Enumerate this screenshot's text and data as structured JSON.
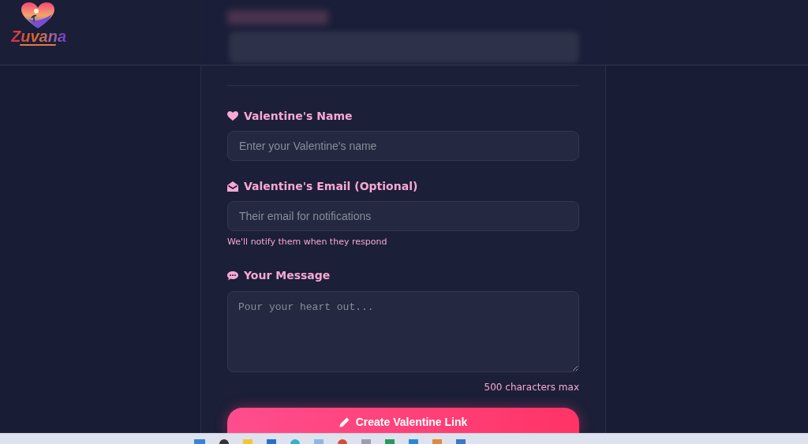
{
  "logo": {
    "text": "Zuvana"
  },
  "fields": [
    {
      "kind": "input",
      "label": "Valentine's Name",
      "placeholder": "Enter your Valentine's name"
    },
    {
      "kind": "input",
      "label": "Valentine's Email (Optional)",
      "placeholder": "Their email for notifications",
      "hint": "We'll notify them when they respond"
    },
    {
      "kind": "textarea",
      "label": "Your Message",
      "placeholder": "Pour your heart out...",
      "counter": "500 characters max"
    }
  ],
  "submit": {
    "label": "Create Valentine Link"
  }
}
